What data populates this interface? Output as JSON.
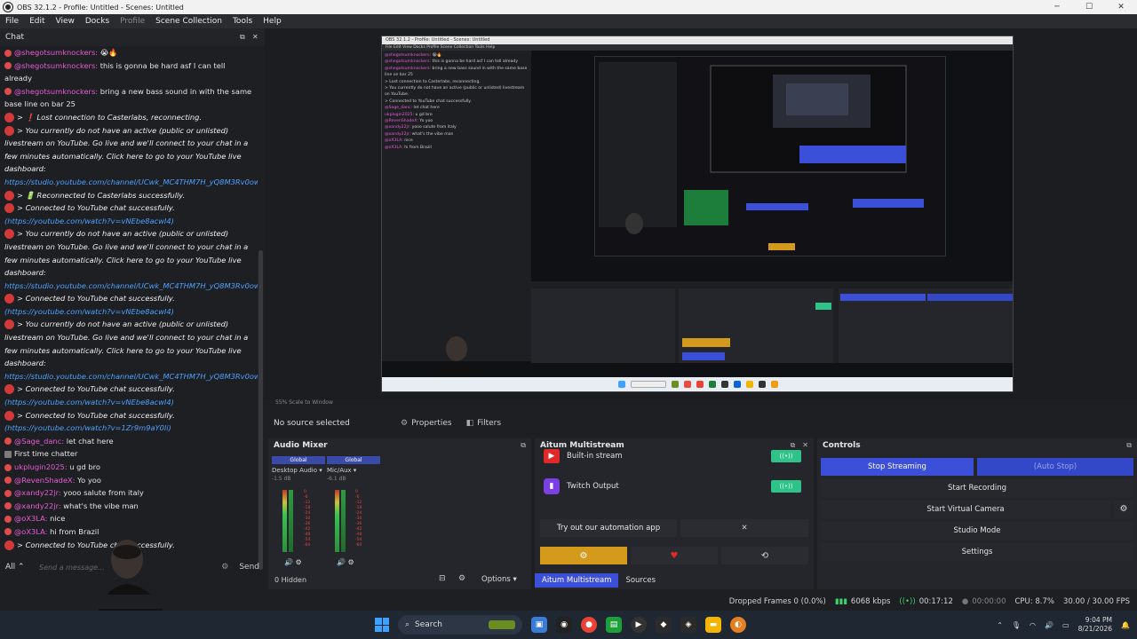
{
  "window": {
    "title": "OBS 32.1.2 - Profile: Untitled - Scenes: Untitled"
  },
  "menu": [
    {
      "label": "File",
      "dim": false
    },
    {
      "label": "Edit",
      "dim": false
    },
    {
      "label": "View",
      "dim": false
    },
    {
      "label": "Docks",
      "dim": false
    },
    {
      "label": "Profile",
      "dim": true
    },
    {
      "label": "Scene Collection",
      "dim": false
    },
    {
      "label": "Tools",
      "dim": false
    },
    {
      "label": "Help",
      "dim": false
    }
  ],
  "chat": {
    "title": "Chat",
    "messages": [
      {
        "type": "user",
        "user": "@shegotsumknockers:",
        "text": " 😭🔥"
      },
      {
        "type": "user",
        "user": "@shegotsumknockers:",
        "text": " this is gonna be hard asf I can tell already"
      },
      {
        "type": "user",
        "user": "@shegotsumknockers:",
        "text": " bring a new bass sound in with the same base line on bar 25"
      },
      {
        "type": "sys",
        "text": "> ❗ Lost connection to Casterlabs, reconnecting."
      },
      {
        "type": "sys",
        "text": "> You currently do not have an active (public or unlisted) livestream on YouTube. Go live and we'll connect to your chat in a few minutes automatically. Click here to go to your YouTube live dashboard:",
        "link": "https://studio.youtube.com/channel/UCwk_MC4THM7H_yQ8M3Rv0ow/livestreaming"
      },
      {
        "type": "sys",
        "text": "> 🔋 Reconnected to Casterlabs successfully."
      },
      {
        "type": "sys",
        "text": "> Connected to YouTube chat successfully.",
        "link": "(https://youtube.com/watch?v=vNEbe8acwI4)"
      },
      {
        "type": "sys",
        "text": "> You currently do not have an active (public or unlisted) livestream on YouTube. Go live and we'll connect to your chat in a few minutes automatically. Click here to go to your YouTube live dashboard:",
        "link": "https://studio.youtube.com/channel/UCwk_MC4THM7H_yQ8M3Rv0ow/livestreaming"
      },
      {
        "type": "sys",
        "text": "> Connected to YouTube chat successfully.",
        "link": "(https://youtube.com/watch?v=vNEbe8acwI4)"
      },
      {
        "type": "sys",
        "text": "> You currently do not have an active (public or unlisted) livestream on YouTube. Go live and we'll connect to your chat in a few minutes automatically. Click here to go to your YouTube live dashboard:",
        "link": "https://studio.youtube.com/channel/UCwk_MC4THM7H_yQ8M3Rv0ow/livestreaming"
      },
      {
        "type": "sys",
        "text": "> Connected to YouTube chat successfully.",
        "link": "(https://youtube.com/watch?v=vNEbe8acwI4)"
      },
      {
        "type": "sys",
        "text": "> Connected to YouTube chat successfully.",
        "link": "(https://youtube.com/watch?v=1Zr9m9aY0li)"
      },
      {
        "type": "user",
        "user": "@Sage_danc:",
        "text": " let chat here"
      },
      {
        "type": "star",
        "text": "First time chatter"
      },
      {
        "type": "user",
        "user": "ukplugin2025:",
        "text": " u gd bro"
      },
      {
        "type": "user",
        "user": "@RevenShadeX:",
        "text": " Yo yoo"
      },
      {
        "type": "user",
        "user": "@xandy22jr:",
        "text": " yooo salute from italy"
      },
      {
        "type": "user",
        "user": "@xandy22jr:",
        "text": " what's the vibe man"
      },
      {
        "type": "user",
        "user": "@oX3LA:",
        "text": " nice"
      },
      {
        "type": "user",
        "user": "@oX3LA:",
        "text": " hi from Brazil"
      },
      {
        "type": "sys",
        "text": "> Connected to YouTube chat successfully.",
        "link": "(https://youtube.com/watch?v=Dnw6rizlm1)"
      }
    ],
    "input": {
      "scope": "All",
      "placeholder": "Send a message...",
      "send_label": "Send"
    }
  },
  "preview": {
    "inner_title": "OBS 32.1.2 - Profile: Untitled - Scenes: Untitled",
    "inner_menu": "File  Edit  View  Docks  Profile  Scene Collection  Tools  Help",
    "inner_chat": [
      {
        "u": "@shegotsumknockers:",
        "t": " 😭🔥"
      },
      {
        "u": "@shegotsumknockers:",
        "t": " this is gonna be hard asf I can tell already"
      },
      {
        "u": "@shegotsumknockers:",
        "t": " bring a new bass sound in with the same base line on bar 25"
      },
      {
        "u": "",
        "t": "> Lost connection to Casterlabs, reconnecting."
      },
      {
        "u": "",
        "t": "> You currently do not have an active (public or unlisted) livestream on YouTube."
      },
      {
        "u": "",
        "t": "> Connected to YouTube chat successfully."
      },
      {
        "u": "@Sage_danc:",
        "t": " let chat here"
      },
      {
        "u": "ukplugin2025:",
        "t": " u gd bro"
      },
      {
        "u": "@RevenShadeX:",
        "t": " Yo yoo"
      },
      {
        "u": "@xandy22jr:",
        "t": " yooo salute from italy"
      },
      {
        "u": "@xandy22jr:",
        "t": " what's the vibe man"
      },
      {
        "u": "@oX3LA:",
        "t": " nice"
      },
      {
        "u": "@oX3LA:",
        "t": " hi from Brazil"
      }
    ],
    "bar_text": "55%   Scale to Window"
  },
  "source_toolbar": {
    "no_source": "No source selected",
    "properties": "Properties",
    "filters": "Filters"
  },
  "audio_mixer": {
    "title": "Audio Mixer",
    "channels": [
      {
        "global": "Global",
        "name": "Desktop Audio",
        "db": "-1.5 dB",
        "level": 0.45
      },
      {
        "global": "Global",
        "name": "Mic/Aux",
        "db": "-6.1 dB",
        "level": 0.6
      }
    ],
    "hidden": "0 Hidden",
    "options": "Options"
  },
  "multistream": {
    "title": "Aitum Multistream",
    "outputs": [
      {
        "name": "Built-in stream",
        "color": "#e02a2a",
        "glyph": "▶"
      },
      {
        "name": "Twitch Output",
        "color": "#7b3fe4",
        "glyph": "▮"
      }
    ],
    "promo": "Try out our automation app",
    "tab_active": "Aitum Multistream",
    "tab_sources": "Sources"
  },
  "controls": {
    "title": "Controls",
    "stop_streaming": "Stop Streaming",
    "auto_stop": "(Auto Stop)",
    "start_recording": "Start Recording",
    "start_virtual_camera": "Start Virtual Camera",
    "studio_mode": "Studio Mode",
    "settings": "Settings"
  },
  "status": {
    "dropped": "Dropped Frames 0 (0.0%)",
    "bitrate": "6068 kbps",
    "stream_time": "00:17:12",
    "rec_time": "00:00:00",
    "cpu": "CPU: 8.7%",
    "fps": "30.00 / 30.00 FPS"
  },
  "taskbar": {
    "search": "Search",
    "time": "9:04 PM",
    "date": "8/21/2026"
  }
}
